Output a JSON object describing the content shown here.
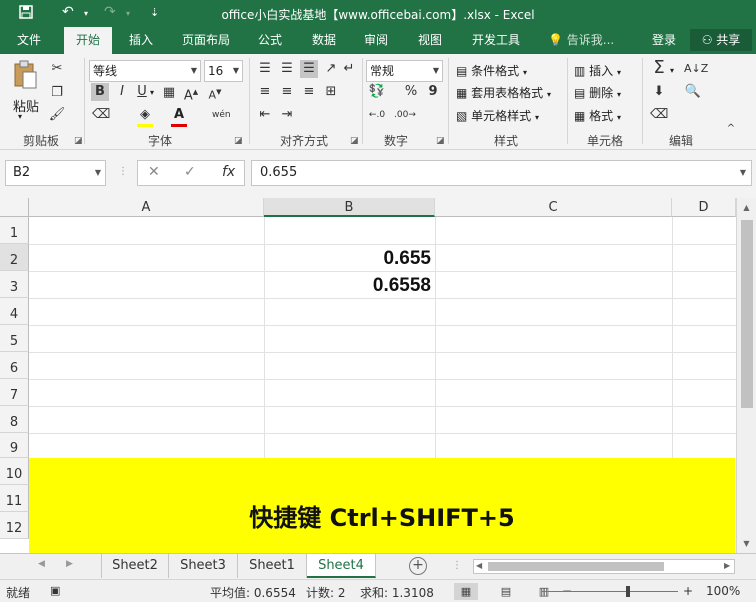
{
  "titlebar": {
    "title": "office小白实战基地【www.officebai.com】.xlsx - Excel",
    "save_icon": "save-icon",
    "undo_icon": "undo-icon",
    "redo_icon": "redo-icon",
    "customize_icon": "customize-qat-icon"
  },
  "tabs": [
    {
      "label": "文件"
    },
    {
      "label": "开始"
    },
    {
      "label": "插入"
    },
    {
      "label": "页面布局"
    },
    {
      "label": "公式"
    },
    {
      "label": "数据"
    },
    {
      "label": "审阅"
    },
    {
      "label": "视图"
    },
    {
      "label": "开发工具"
    }
  ],
  "tellme": "告诉我...",
  "login": "登录",
  "share": "共享",
  "ribbon": {
    "clipboard": {
      "paste": "粘贴",
      "label": "剪贴板"
    },
    "font": {
      "name": "等线",
      "size": "16",
      "label": "字体",
      "bold": "B",
      "italic": "I",
      "underline": "U",
      "grow": "A",
      "shrink": "A",
      "phonetic": "wén"
    },
    "alignment": {
      "label": "对齐方式"
    },
    "number": {
      "format": "常规",
      "percent": "%",
      "comma": "9",
      "label": "数字"
    },
    "styles": {
      "conditional": "条件格式",
      "table": "套用表格格式",
      "cell": "单元格样式",
      "label": "样式"
    },
    "cells": {
      "insert": "插入",
      "delete": "删除",
      "format": "格式",
      "label": "单元格"
    },
    "editing": {
      "label": "编辑"
    }
  },
  "formula_bar": {
    "namebox": "B2",
    "formula": "0.655"
  },
  "grid": {
    "columns": [
      "A",
      "B",
      "C",
      "D"
    ],
    "rows": [
      "1",
      "2",
      "3",
      "4",
      "5",
      "6",
      "7",
      "8",
      "9",
      "10",
      "11",
      "12"
    ],
    "cells": {
      "B2": "0.655",
      "B3": "0.6558"
    },
    "banner_text": "快捷键 Ctrl+SHIFT+5",
    "banner_color": "#ffff00"
  },
  "sheets": [
    {
      "label": "Sheet2"
    },
    {
      "label": "Sheet3"
    },
    {
      "label": "Sheet1"
    },
    {
      "label": "Sheet4"
    }
  ],
  "status": {
    "ready": "就绪",
    "average": "平均值: 0.6554",
    "count": "计数: 2",
    "sum": "求和: 1.3108",
    "zoom": "100%"
  },
  "colors": {
    "brand": "#217346"
  }
}
